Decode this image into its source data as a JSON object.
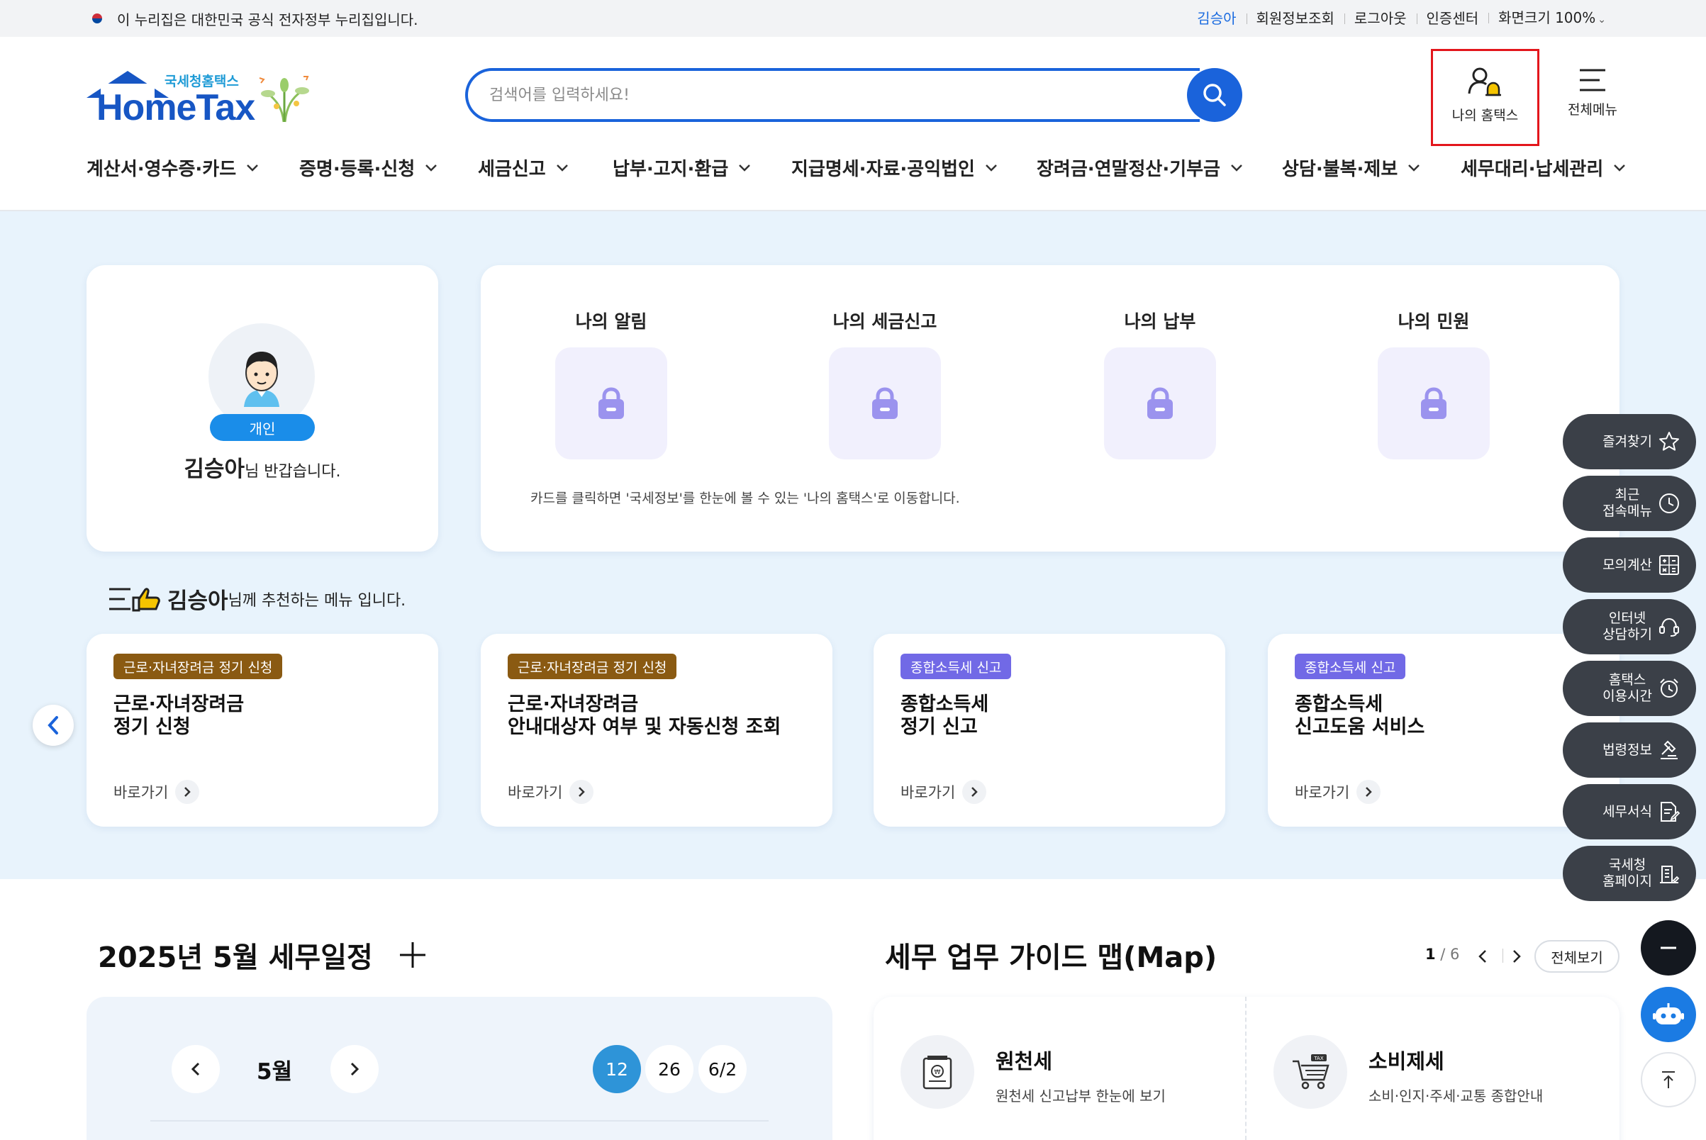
{
  "topbar": {
    "notice": "이 누리집은 대한민국 공식 전자정부 누리집입니다.",
    "user_name": "김승아",
    "member_info": "회원정보조회",
    "logout": "로그아웃",
    "cert_center": "인증센터",
    "zoom_label": "화면크기 100%"
  },
  "header": {
    "logo_sub": "국세청홈택스",
    "logo_text": "HomeTax",
    "search_placeholder": "검색어를 입력하세요!",
    "my_hometax": "나의 홈택스",
    "all_menu": "전체메뉴"
  },
  "gnb": [
    "계산서·영수증·카드",
    "증명·등록·신청",
    "세금신고",
    "납부·고지·환급",
    "지급명세·자료·공익법인",
    "장려금·연말정산·기부금",
    "상담·불복·제보",
    "세무대리·납세관리"
  ],
  "profile": {
    "type_badge": "개인",
    "name": "김승아",
    "greeting_suffix": "님 반갑습니다."
  },
  "my_tiles": {
    "items": [
      "나의 알림",
      "나의 세금신고",
      "나의 납부",
      "나의 민원"
    ],
    "note": "카드를 클릭하면 '국세정보'를 한눈에 볼 수 있는 '나의 홈택스'로 이동합니다."
  },
  "recommend": {
    "name": "김승아",
    "suffix": "님께 추천하는 메뉴 입니다.",
    "go_label": "바로가기",
    "cards": [
      {
        "tag": "근로·자녀장려금 정기 신청",
        "line1": "근로·자녀장려금",
        "line2": "정기 신청",
        "tag_color": "#8a5a12"
      },
      {
        "tag": "근로·자녀장려금 정기 신청",
        "line1": "근로·자녀장려금",
        "line2": "안내대상자 여부 및 자동신청 조회",
        "tag_color": "#8a5a12"
      },
      {
        "tag": "종합소득세 신고",
        "line1": "종합소득세",
        "line2": "정기 신고",
        "tag_color": "#7169e6"
      },
      {
        "tag": "종합소득세 신고",
        "line1": "종합소득세",
        "line2": "신고도움 서비스",
        "tag_color": "#7169e6"
      }
    ]
  },
  "schedule": {
    "title": "2025년 5월 세무일정",
    "month": "5월",
    "dates": [
      "12",
      "26",
      "6/2"
    ],
    "selected_date": "12"
  },
  "guide_map": {
    "title": "세무 업무 가이드 맵(Map)",
    "page_current": "1",
    "page_total": " / 6",
    "view_all": "전체보기",
    "items": [
      {
        "title": "원천세",
        "desc": "원천세 신고납부 한눈에 보기"
      },
      {
        "title": "소비제세",
        "desc": "소비·인지·주세·교통 종합안내"
      }
    ]
  },
  "quick_menu": [
    {
      "line1": "즐겨찾기",
      "line2": "",
      "icon": "star-icon"
    },
    {
      "line1": "최근",
      "line2": "접속메뉴",
      "icon": "clock-icon"
    },
    {
      "line1": "모의계산",
      "line2": "",
      "icon": "calculator-icon"
    },
    {
      "line1": "인터넷",
      "line2": "상담하기",
      "icon": "chat-icon"
    },
    {
      "line1": "홈택스",
      "line2": "이용시간",
      "icon": "alarm-clock-icon"
    },
    {
      "line1": "법령정보",
      "line2": "",
      "icon": "gavel-icon"
    },
    {
      "line1": "세무서식",
      "line2": "",
      "icon": "document-icon"
    },
    {
      "line1": "국세청",
      "line2": "홈페이지",
      "icon": "building-icon"
    }
  ],
  "colors": {
    "brand_blue": "#1a63db",
    "section_bg": "#e8f3fc",
    "highlight_border": "#e3161c"
  }
}
